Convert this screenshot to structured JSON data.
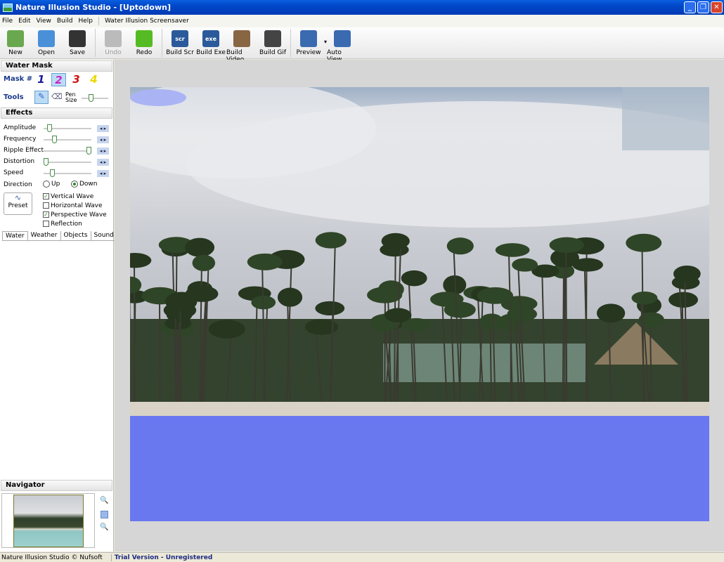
{
  "window": {
    "title": "Nature Illusion Studio - [Uptodown]"
  },
  "menu": [
    "File",
    "Edit",
    "View",
    "Build",
    "Help"
  ],
  "menu_extra": "Water Illusion Screensaver",
  "toolbar": [
    {
      "label": "New",
      "icon": "new-icon",
      "color": "#6aa84f"
    },
    {
      "label": "Open",
      "icon": "open-icon",
      "color": "#4a90d9"
    },
    {
      "label": "Save",
      "icon": "save-icon",
      "color": "#333333"
    },
    {
      "label": "Undo",
      "icon": "undo-icon",
      "color": "#bbbbbb",
      "disabled": true
    },
    {
      "label": "Redo",
      "icon": "redo-icon",
      "color": "#55bb22"
    },
    {
      "label": "Build Scr",
      "icon": "scr",
      "color": "#2a5a9a"
    },
    {
      "label": "Build Exe",
      "icon": "exe",
      "color": "#2a5a9a"
    },
    {
      "label": "Build Video",
      "icon": "film-reel-icon",
      "color": "#886644"
    },
    {
      "label": "Build Gif",
      "icon": "film-icon",
      "color": "#444444"
    },
    {
      "label": "Preview",
      "icon": "preview-icon",
      "color": "#3a6ab0"
    },
    {
      "label": "Auto View",
      "icon": "auto-view-icon",
      "color": "#3a6ab0"
    }
  ],
  "left": {
    "water_mask": "Water Mask",
    "mask_label": "Mask #",
    "masks": [
      {
        "n": "1",
        "color": "#1a1a9a"
      },
      {
        "n": "2",
        "color": "#cc22cc",
        "selected": true
      },
      {
        "n": "3",
        "color": "#cc1111"
      },
      {
        "n": "4",
        "color": "#e8d800"
      }
    ],
    "tools_label": "Tools",
    "pen_size": "Pen Size",
    "pen_size_value": 0.3,
    "effects": "Effects",
    "sliders": [
      {
        "label": "Amplitude",
        "value": 0.08
      },
      {
        "label": "Frequency",
        "value": 0.2
      },
      {
        "label": "Ripple Effect",
        "value": 0.98
      },
      {
        "label": "Distortion",
        "value": 0.0
      },
      {
        "label": "Speed",
        "value": 0.15
      }
    ],
    "direction_label": "Direction",
    "direction_options": [
      "Up",
      "Down"
    ],
    "direction_selected": "Down",
    "preset": "Preset",
    "checks": [
      {
        "label": "Vertical Wave",
        "checked": true
      },
      {
        "label": "Horizontal Wave",
        "checked": false
      },
      {
        "label": "Perspective Wave",
        "checked": true
      },
      {
        "label": "Reflection",
        "checked": false
      }
    ],
    "tabs": [
      "Water",
      "Weather",
      "Objects",
      "Sound"
    ],
    "navigator": "Navigator"
  },
  "status": {
    "copyright": "Nature Illusion Studio © Nufsoft",
    "trial": "Trial Version - Unregistered"
  },
  "colors": {
    "water_mask": "#6a78f0"
  }
}
